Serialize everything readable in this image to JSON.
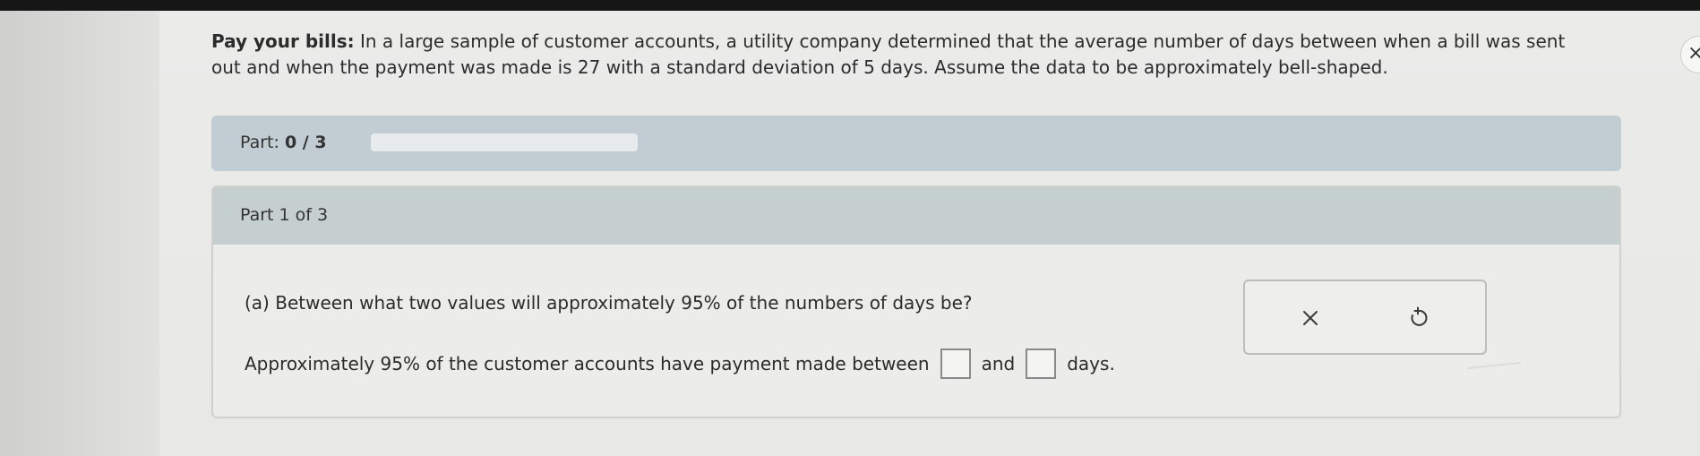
{
  "problem": {
    "lead": "Pay your bills:",
    "text": " In a large sample of customer accounts, a utility company determined that the average number of days between when a bill was sent out and when the payment was made is 27 with a standard deviation of 5 days. Assume the data to be approximately bell-shaped."
  },
  "progress": {
    "label": "Part:",
    "value": "0 / 3",
    "fraction": 0
  },
  "card": {
    "header": "Part 1 of 3",
    "question": "(a) Between what two values will approximately 95% of the numbers of days be?",
    "answer_prefix": "Approximately 95% of the customer accounts have payment made between",
    "answer_middle": "and",
    "answer_suffix": "days.",
    "answer_low_value": "",
    "answer_high_value": ""
  },
  "actions": {
    "clear_icon": "x-icon",
    "undo_icon": "undo-icon"
  },
  "window": {
    "close_glyph": "×"
  },
  "colors": {
    "progress_fill": "#5aa0c8",
    "part_bar": "#c1cdd2",
    "card_header": "#c6cfcf"
  }
}
